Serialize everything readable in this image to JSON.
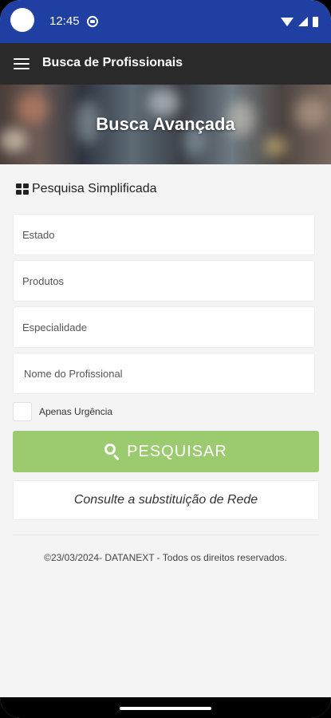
{
  "status_bar": {
    "time": "12:45"
  },
  "app_bar": {
    "title": "Busca de Profissionais"
  },
  "hero": {
    "title": "Busca Avançada"
  },
  "form": {
    "section_title": "Pesquisa Simplificada",
    "fields": [
      {
        "placeholder": "Estado",
        "value": ""
      },
      {
        "placeholder": "Produtos",
        "value": ""
      },
      {
        "placeholder": "Especialidade",
        "value": ""
      },
      {
        "placeholder": "Nome do Profissional",
        "value": ""
      }
    ],
    "urgency_label": "Apenas Urgência",
    "urgency_checked": false,
    "search_label": "PESQUISAR",
    "rede_label": "Consulte a substituição de Rede"
  },
  "footer": {
    "text": "©23/03/2024- DATANEXT - Todos os direitos reservados."
  },
  "colors": {
    "status_bar": "#1f3fa3",
    "app_bar": "#2a2a2a",
    "search_button": "#9ccb6f",
    "background": "#f4f4f4"
  },
  "icons": [
    "menu-icon",
    "grid-icon",
    "search-icon",
    "wifi-icon",
    "signal-icon",
    "battery-icon"
  ]
}
